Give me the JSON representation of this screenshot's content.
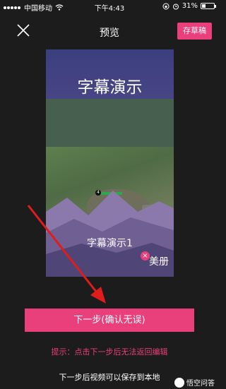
{
  "status_bar": {
    "carrier": "中国移动",
    "time": "下午4:43",
    "battery_percent": "31%",
    "battery_level": 0.31
  },
  "nav": {
    "title": "预览",
    "save_draft_label": "存草稿"
  },
  "preview": {
    "title": "字幕演示",
    "subtitle": "字幕演示1",
    "watermark": "美册",
    "game_level": "4"
  },
  "actions": {
    "next_label": "下一步(确认无误)",
    "hint": "提示：点击下一步后无法返回编辑",
    "note": "下一步后视频可以保存到本地"
  },
  "brand": {
    "name": "悟空问答"
  },
  "colors": {
    "accent": "#e93f7a",
    "background": "#1c1c1c"
  }
}
